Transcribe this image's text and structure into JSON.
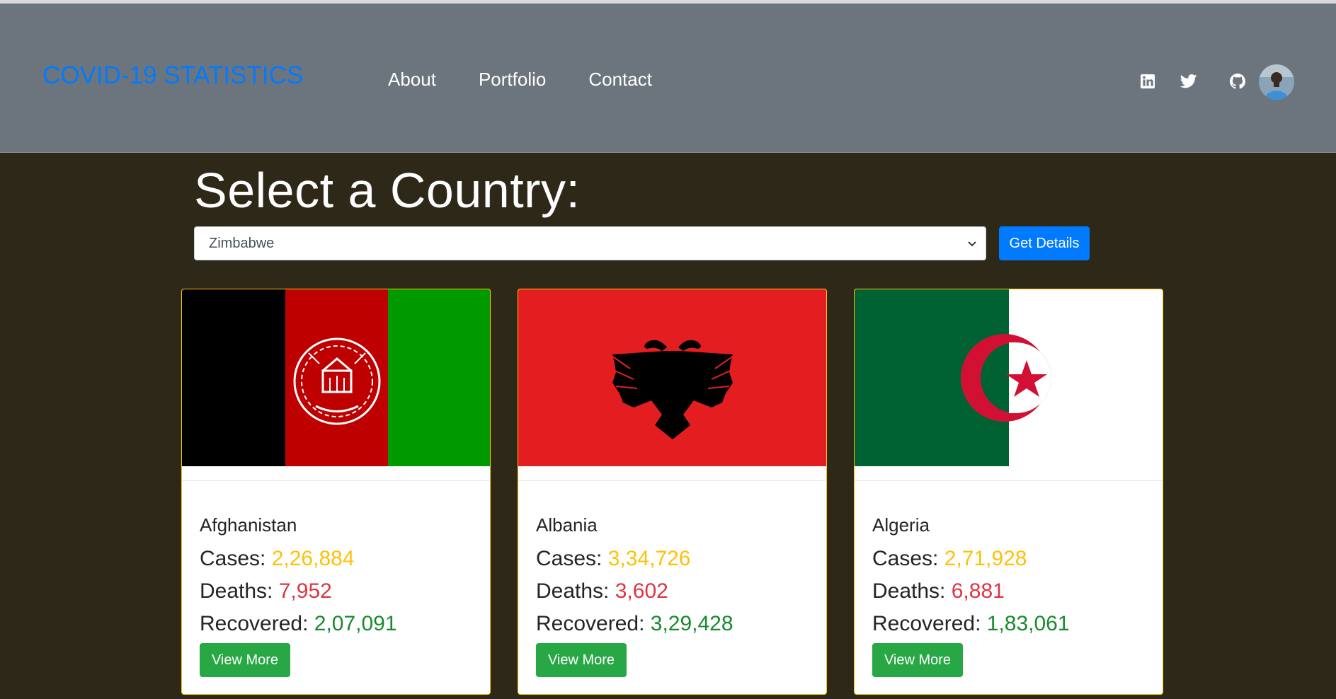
{
  "navbar": {
    "brand": "COVID-19 STATISTICS",
    "links": [
      {
        "label": "About"
      },
      {
        "label": "Portfolio"
      },
      {
        "label": "Contact"
      }
    ],
    "icons": [
      "linkedin-icon",
      "twitter-icon",
      "github-icon",
      "avatar"
    ]
  },
  "main": {
    "heading": "Select a Country:",
    "select": {
      "selected": "Zimbabwe"
    },
    "get_details_label": "Get Details"
  },
  "cards": [
    {
      "country": "Afghanistan",
      "cases_label": "Cases:",
      "cases": "2,26,884",
      "deaths_label": "Deaths:",
      "deaths": "7,952",
      "recovered_label": "Recovered:",
      "recovered": "2,07,091",
      "button": "View More"
    },
    {
      "country": "Albania",
      "cases_label": "Cases:",
      "cases": "3,34,726",
      "deaths_label": "Deaths:",
      "deaths": "3,602",
      "recovered_label": "Recovered:",
      "recovered": "3,29,428",
      "button": "View More"
    },
    {
      "country": "Algeria",
      "cases_label": "Cases:",
      "cases": "2,71,928",
      "deaths_label": "Deaths:",
      "deaths": "6,881",
      "recovered_label": "Recovered:",
      "recovered": "1,83,061",
      "button": "View More"
    }
  ],
  "colors": {
    "navbar": "#6c757d",
    "background": "#2e2818",
    "brand": "#007bff",
    "cases": "#ffc107",
    "deaths": "#dc3545",
    "recovered": "#198a2e",
    "primary_button": "#007bff",
    "success_button": "#28a745"
  }
}
